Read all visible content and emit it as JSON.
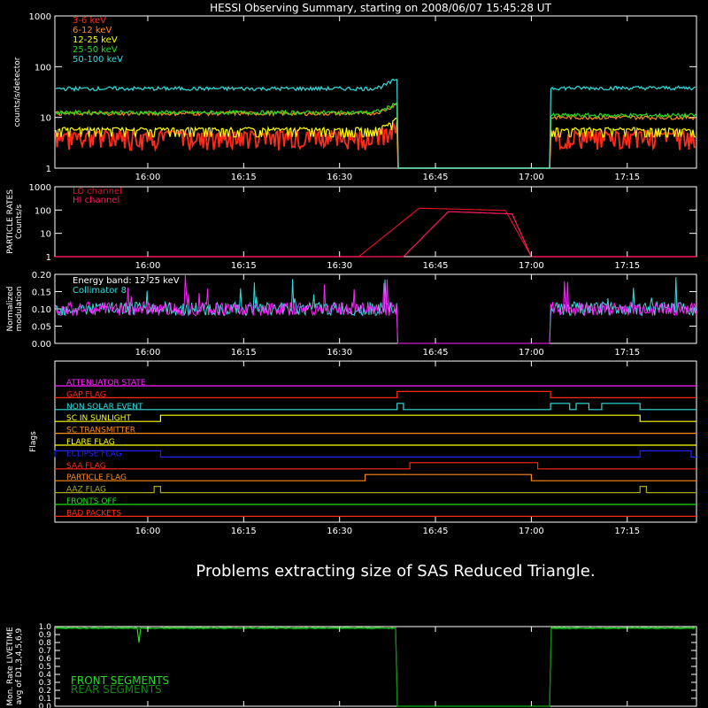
{
  "title": "HESSI Observing Summary, starting on 2008/06/07 15:45:28 UT",
  "time_ticks": [
    "16:00",
    "16:15",
    "16:30",
    "16:45",
    "17:00",
    "17:15"
  ],
  "message": "Problems extracting size of SAS Reduced Triangle.",
  "chart_data": [
    {
      "type": "line",
      "id": "counts",
      "ylabel": "counts/s/detector",
      "yscale": "log",
      "ylim": [
        1,
        1000
      ],
      "yticks": [
        "1",
        "10",
        "100",
        "1000"
      ],
      "series": [
        {
          "name": "3-6 keV",
          "color": "#ff2a1a",
          "level_before": 4.5,
          "level_after": 4.5
        },
        {
          "name": "6-12 keV",
          "color": "#ff8a1a",
          "level_before": 12,
          "level_after": 10
        },
        {
          "name": "12-25 keV",
          "color": "#ffff00",
          "level_before": 5.5,
          "level_after": 5.5
        },
        {
          "name": "25-50 keV",
          "color": "#22dd22",
          "level_before": 12.5,
          "level_after": 11
        },
        {
          "name": "50-100 keV",
          "color": "#33dddd",
          "level_before": 37,
          "level_after": 38
        }
      ],
      "gap": [
        "16:39",
        "17:03"
      ]
    },
    {
      "type": "line",
      "id": "particle",
      "ylabel": "PARTICLE RATES\nCounts/s",
      "yscale": "log",
      "ylim": [
        1,
        1000
      ],
      "yticks": [
        "1",
        "10",
        "100",
        "1000"
      ],
      "series": [
        {
          "name": "LO channel",
          "color": "#dd1122",
          "start": "16:33",
          "end": "17:00",
          "peak": 120
        },
        {
          "name": "HI channel",
          "color": "#ff1a60",
          "start": "16:40",
          "end": "17:00",
          "peak": 85
        }
      ]
    },
    {
      "type": "line",
      "id": "modulation",
      "ylabel": "Normalized\nmodulation",
      "ylim": [
        0,
        0.2
      ],
      "yticks": [
        "0.00",
        "0.05",
        "0.10",
        "0.15",
        "0.20"
      ],
      "annotations": [
        "Energy band: 12-25 keV",
        "Collimator 8"
      ],
      "series": [
        {
          "name": "Collimator 8",
          "color": "#33dddd",
          "level": 0.1
        },
        {
          "name": "modulation",
          "color": "#ff22ff",
          "level": 0.1
        }
      ],
      "gap": [
        "16:39",
        "17:03"
      ]
    },
    {
      "type": "line",
      "id": "flags",
      "ylabel": "Flags",
      "series": [
        {
          "name": "ATTENUATOR STATE",
          "color": "#ff22ff",
          "high": []
        },
        {
          "name": "GAP FLAG",
          "color": "#ff2a1a",
          "high": [
            [
              "16:39",
              "17:03"
            ]
          ]
        },
        {
          "name": "NON SOLAR EVENT",
          "color": "#33dddd",
          "high": [
            [
              "16:39",
              "16:40"
            ],
            [
              "17:03",
              "17:06"
            ],
            [
              "17:07",
              "17:09"
            ],
            [
              "17:11",
              "17:17"
            ]
          ]
        },
        {
          "name": "SC IN SUNLIGHT",
          "color": "#ffff00",
          "high": [
            [
              "16:02",
              "17:17"
            ]
          ]
        },
        {
          "name": "SC TRANSMITTER",
          "color": "#ff8a1a",
          "high": []
        },
        {
          "name": "FLARE FLAG",
          "color": "#ffff00",
          "high": []
        },
        {
          "name": "ECLIPSE FLAG",
          "color": "#2222ff",
          "high": [
            [
              "15:45",
              "16:02"
            ],
            [
              "17:17",
              "17:25"
            ]
          ]
        },
        {
          "name": "SAA FLAG",
          "color": "#ff2a1a",
          "high": [
            [
              "16:41",
              "17:01"
            ]
          ]
        },
        {
          "name": "PARTICLE FLAG",
          "color": "#ff8a1a",
          "high": [
            [
              "16:34",
              "17:00"
            ]
          ]
        },
        {
          "name": "AAZ FLAG",
          "color": "#aaaa22",
          "high": [
            [
              "16:01",
              "16:02"
            ],
            [
              "17:17",
              "17:18"
            ]
          ]
        },
        {
          "name": "FRONTS OFF",
          "color": "#22dd22",
          "high": []
        },
        {
          "name": "BAD PACKETS",
          "color": "#ff2a1a",
          "high": []
        }
      ]
    },
    {
      "type": "line",
      "id": "livetime",
      "ylabel": "Mon. Rate LIVETIME\navg of D1,3,4,5,6,9",
      "ylim": [
        0,
        1
      ],
      "yticks": [
        "0.0",
        "0.1",
        "0.2",
        "0.3",
        "0.4",
        "0.5",
        "0.6",
        "0.7",
        "0.8",
        "0.9",
        "1.0"
      ],
      "series": [
        {
          "name": "FRONT SEGMENTS",
          "color": "#22dd22",
          "level": 0.99
        },
        {
          "name": "REAR SEGMENTS",
          "color": "#118811",
          "level": 0.98
        }
      ],
      "gap": [
        "16:39",
        "17:03"
      ]
    }
  ]
}
